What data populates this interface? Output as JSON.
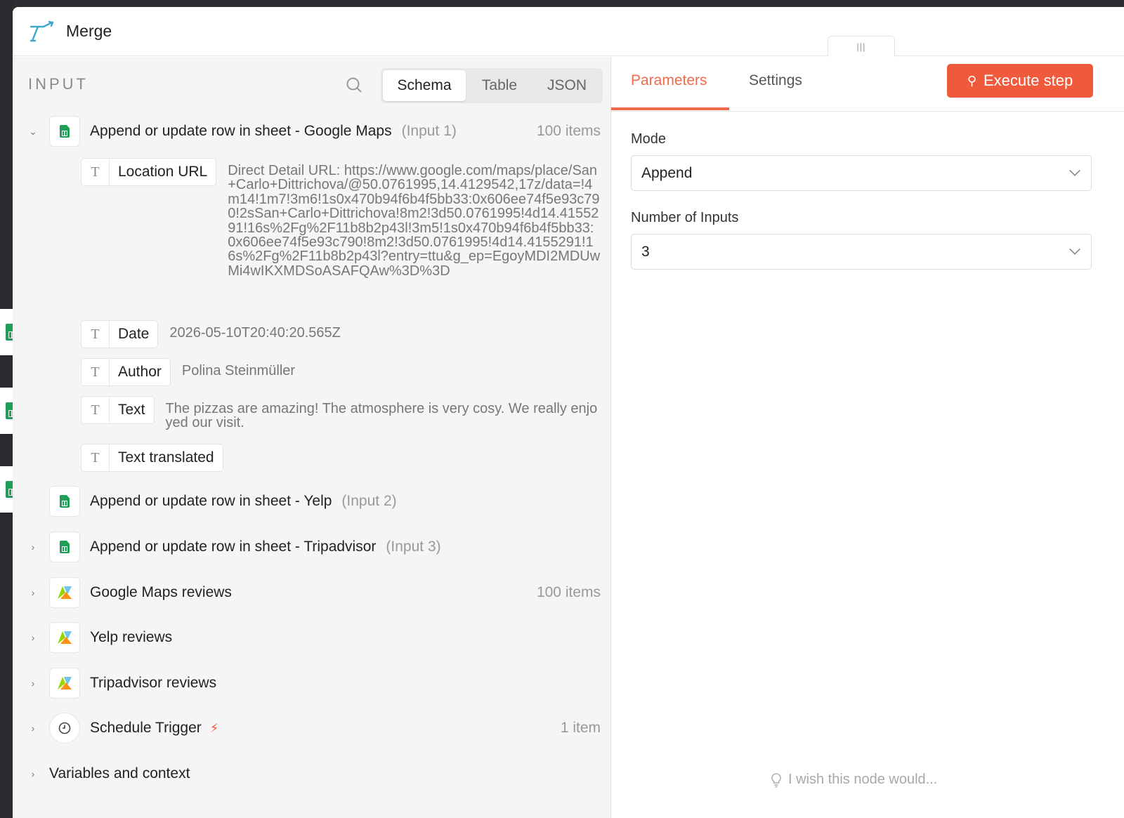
{
  "header": {
    "title": "Merge"
  },
  "input_panel": {
    "label": "INPUT",
    "view_tabs": [
      "Schema",
      "Table",
      "JSON"
    ],
    "active_view": "Schema",
    "nodes": [
      {
        "name": "Append or update row in sheet - Google Maps",
        "sub": "(Input 1)",
        "count": "100 items",
        "chevron": "down",
        "icon": "sheets-icon"
      },
      {
        "name": "Append or update row in sheet - Yelp",
        "sub": "(Input 2)",
        "count": "",
        "chevron": "none",
        "icon": "sheets-icon"
      },
      {
        "name": "Append or update row in sheet - Tripadvisor",
        "sub": "(Input 3)",
        "count": "",
        "chevron": "right",
        "icon": "sheets-icon"
      },
      {
        "name": "Google Maps reviews",
        "sub": "",
        "count": "100 items",
        "chevron": "right",
        "icon": "apify-icon"
      },
      {
        "name": "Yelp reviews",
        "sub": "",
        "count": "",
        "chevron": "right",
        "icon": "apify-icon"
      },
      {
        "name": "Tripadvisor reviews",
        "sub": "",
        "count": "",
        "chevron": "right",
        "icon": "apify-icon"
      },
      {
        "name": "Schedule Trigger",
        "sub": "",
        "count": "1 item",
        "chevron": "right",
        "icon": "clock-icon"
      }
    ],
    "fields": [
      {
        "label": "Location URL",
        "value": "Direct Detail URL: https://www.google.com/maps/place/San+Carlo+Dittrichova/@50.0761995,14.4129542,17z/data=!4m14!1m7!3m6!1s0x470b94f6b4f5bb33:0x606ee74f5e93c790!2sSan+Carlo+Dittrichova!8m2!3d50.0761995!4d14.4155291!16s%2Fg%2F11b8b2p43l!3m5!1s0x470b94f6b4f5bb33:0x606ee74f5e93c790!8m2!3d50.0761995!4d14.4155291!16s%2Fg%2F11b8b2p43l?entry=ttu&g_ep=EgoyMDI2MDUwMi4wIKXMDSoASAFQAw%3D%3D"
      },
      {
        "label": "Date",
        "value": "2026-05-10T20:40:20.565Z"
      },
      {
        "label": "Author",
        "value": "Polina Steinmüller"
      },
      {
        "label": "Text",
        "value": "The pizzas are amazing! The atmosphere is very cosy. We really enjoyed our visit."
      },
      {
        "label": "Text translated",
        "value": ""
      }
    ],
    "variables_label": "Variables and context"
  },
  "params_panel": {
    "tabs": [
      "Parameters",
      "Settings"
    ],
    "active_tab": "Parameters",
    "execute_label": "Execute step",
    "mode": {
      "label": "Mode",
      "value": "Append"
    },
    "num_inputs": {
      "label": "Number of Inputs",
      "value": "3"
    },
    "wish": "I wish this node would..."
  },
  "colors": {
    "accent": "#ef5a3c",
    "tab_active": "#ef6a4b",
    "sheets_green": "#1e9e57",
    "panel_bg": "#f5f5f5"
  }
}
